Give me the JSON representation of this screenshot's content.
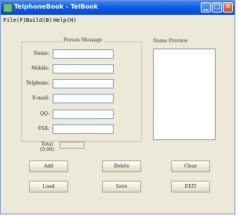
{
  "window": {
    "title": "TelphoneBook - TelBook"
  },
  "menu": {
    "items": [
      "File(F)",
      "Build(B)",
      "Help(H)"
    ]
  },
  "person_group": {
    "title": "Person Message",
    "fields": [
      {
        "label": "Name:",
        "value": ""
      },
      {
        "label": "Mobile:",
        "value": ""
      },
      {
        "label": "Telphone:",
        "value": ""
      },
      {
        "label": "E-mail:",
        "value": ""
      },
      {
        "label": "QQ:",
        "value": ""
      },
      {
        "label": "FAX:",
        "value": ""
      }
    ]
  },
  "preview": {
    "title": "Name Preview"
  },
  "total": {
    "label_line1": "Total",
    "label_line2": "(0-99)",
    "value": ""
  },
  "buttons": {
    "add": "Add",
    "delete": "Delete",
    "clear": "Clear",
    "load": "Load",
    "save": "Save",
    "exit": "EXIT"
  },
  "titlebar_controls": {
    "minimize_icon": "minimize-icon",
    "maximize_icon": "maximize-icon",
    "close_icon": "close-icon"
  }
}
